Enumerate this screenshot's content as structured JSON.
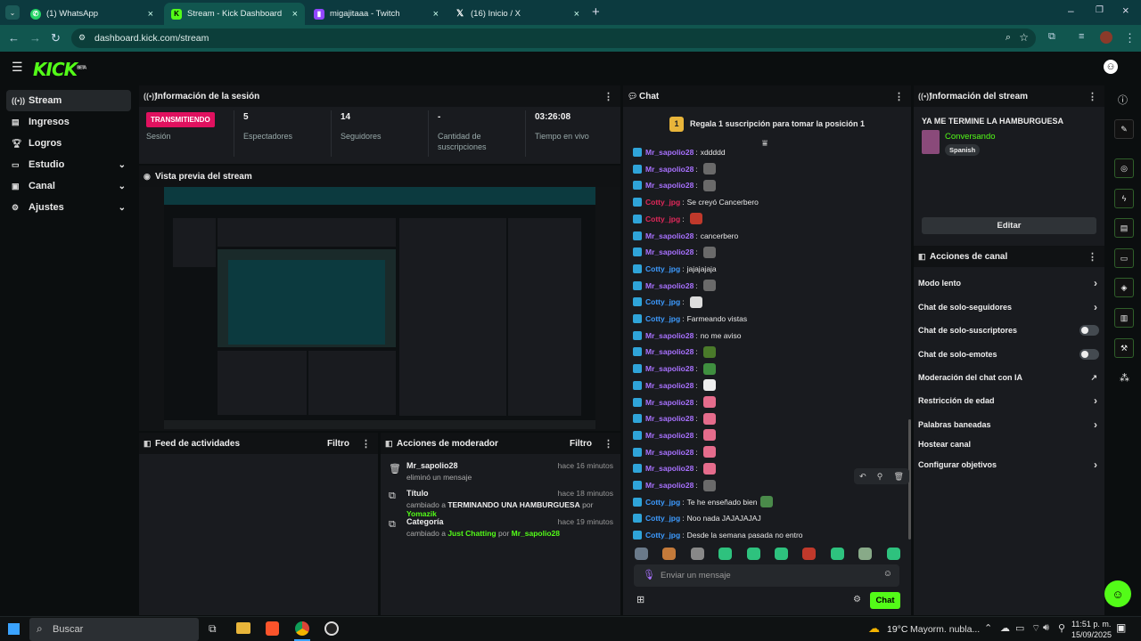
{
  "browser": {
    "tabs": [
      {
        "label": "(1) WhatsApp",
        "icon": "whatsapp-icon",
        "color": "#25d366"
      },
      {
        "label": "Stream - Kick Dashboard",
        "icon": "kick-icon",
        "color": "#53fc18"
      },
      {
        "label": "migajitaaa - Twitch",
        "icon": "twitch-icon",
        "color": "#9146ff"
      },
      {
        "label": "(16) Inicio / X",
        "icon": "x-icon",
        "color": "#000000"
      }
    ],
    "url": "dashboard.kick.com/stream"
  },
  "kick": {
    "logo": "KICK",
    "beta": "BETA",
    "accent": "#53fc18"
  },
  "sidebar": {
    "items": [
      {
        "label": "Stream",
        "icon": "broadcast-icon"
      },
      {
        "label": "Ingresos",
        "icon": "money-icon"
      },
      {
        "label": "Logros",
        "icon": "trophy-icon"
      },
      {
        "label": "Estudio",
        "icon": "studio-icon"
      },
      {
        "label": "Canal",
        "icon": "channel-icon"
      },
      {
        "label": "Ajustes",
        "icon": "gear-icon"
      }
    ]
  },
  "session": {
    "title": "Información de la sesión",
    "live_badge": "TRANSMITIENDO",
    "session_label": "Sesión",
    "stats": [
      {
        "value": "5",
        "label": "Espectadores"
      },
      {
        "value": "14",
        "label": "Seguidores"
      },
      {
        "value": "-",
        "label": "Cantidad de suscripciones"
      },
      {
        "value": "03:26:08",
        "label": "Tiempo en vivo"
      }
    ]
  },
  "preview": {
    "title": "Vista previa del stream"
  },
  "activity": {
    "title": "Feed de actividades",
    "filter": "Filtro"
  },
  "moderator": {
    "title": "Acciones de moderador",
    "filter": "Filtro",
    "items": [
      {
        "title": "Mr_sapolio28",
        "desc": "eliminó un mensaje",
        "time": "hace 16 minutos",
        "icon": "trash-icon"
      },
      {
        "title": "Título",
        "desc_pre": "cambiado a ",
        "value": "TERMINANDO UNA HAMBURGUESA",
        "by_pre": " por ",
        "by": "Yomazik",
        "time": "hace 18 minutos",
        "icon": "title-icon"
      },
      {
        "title": "Categoría",
        "desc_pre": "cambiado a ",
        "value": "Just Chatting",
        "by_pre": " por ",
        "by": "Mr_sapolio28",
        "time": "hace 19 minutos",
        "icon": "category-icon"
      }
    ]
  },
  "chat": {
    "title": "Chat",
    "gift_banner": "Regala 1 suscripción para tomar la posición 1",
    "gift_pos": "1",
    "messages": [
      {
        "user": "Mr_sapolio28",
        "text": "xddddd",
        "cls": "u-mr"
      },
      {
        "user": "Mr_sapolio28",
        "text": "",
        "cls": "u-mr",
        "emote": "#6a6a6a"
      },
      {
        "user": "Mr_sapolio28",
        "text": "",
        "cls": "u-mr",
        "emote": "#6a6a6a"
      },
      {
        "user": "Cotty_jpg",
        "text": "Se creyó Cancerbero",
        "cls": "u-cr"
      },
      {
        "user": "Cotty_jpg",
        "text": "",
        "cls": "u-cr",
        "emote": "#c0392b"
      },
      {
        "user": "Mr_sapolio28",
        "text": "cancerbero",
        "cls": "u-mr"
      },
      {
        "user": "Mr_sapolio28",
        "text": "",
        "cls": "u-mr",
        "emote": "#6a6a6a"
      },
      {
        "user": "Cotty_jpg",
        "text": "jajajajaja",
        "cls": "u-cb"
      },
      {
        "user": "Mr_sapolio28",
        "text": "",
        "cls": "u-mr",
        "emote": "#6a6a6a"
      },
      {
        "user": "Cotty_jpg",
        "text": "",
        "cls": "u-cb",
        "emote": "#dddddd"
      },
      {
        "user": "Cotty_jpg",
        "text": "Farmeando vistas",
        "cls": "u-cb"
      },
      {
        "user": "Mr_sapolio28",
        "text": "no me aviso",
        "cls": "u-mr"
      },
      {
        "user": "Mr_sapolio28",
        "text": "",
        "cls": "u-mr",
        "emote": "#4a7a2a"
      },
      {
        "user": "Mr_sapolio28",
        "text": "",
        "cls": "u-mr",
        "emote": "#3f8f3f"
      },
      {
        "user": "Mr_sapolio28",
        "text": "",
        "cls": "u-mr",
        "emote": "#eeeeee"
      },
      {
        "user": "Mr_sapolio28",
        "text": "",
        "cls": "u-mr",
        "emote": "#e56c8c"
      },
      {
        "user": "Mr_sapolio28",
        "text": "",
        "cls": "u-mr",
        "emote": "#e56c8c"
      },
      {
        "user": "Mr_sapolio28",
        "text": "",
        "cls": "u-mr",
        "emote": "#e56c8c"
      },
      {
        "user": "Mr_sapolio28",
        "text": "",
        "cls": "u-mr",
        "emote": "#e56c8c"
      },
      {
        "user": "Mr_sapolio28",
        "text": "",
        "cls": "u-mr",
        "emote": "#e56c8c"
      },
      {
        "user": "Mr_sapolio28",
        "text": "",
        "cls": "u-mr",
        "emote": "#6a6a6a"
      },
      {
        "user": "Cotty_jpg",
        "text": "Te he enseñado bien",
        "cls": "u-cb",
        "emote": "#4a8a4a"
      },
      {
        "user": "Cotty_jpg",
        "text": "Noo nada JAJAJAJAJ",
        "cls": "u-cb"
      },
      {
        "user": "Cotty_jpg",
        "text": "Desde la semana pasada no entro",
        "cls": "u-cb"
      }
    ],
    "input_placeholder": "Enviar un mensaje",
    "send_label": "Chat"
  },
  "stream_info": {
    "title": "Información del stream",
    "stream_title": "YA ME TERMINE LA HAMBURGUESA",
    "category": "Conversando",
    "language": "Spanish",
    "edit": "Editar"
  },
  "channel_actions": {
    "title": "Acciones de canal",
    "items": [
      {
        "label": "Modo lento",
        "kind": "arrow"
      },
      {
        "label": "Chat de solo-seguidores",
        "kind": "arrow"
      },
      {
        "label": "Chat de solo-suscriptores",
        "kind": "toggle"
      },
      {
        "label": "Chat de solo-emotes",
        "kind": "toggle"
      },
      {
        "label": "Moderación del chat con IA",
        "kind": "external"
      },
      {
        "label": "Restricción de edad",
        "kind": "arrow"
      },
      {
        "label": "Palabras baneadas",
        "kind": "arrow"
      },
      {
        "label": "Hostear canal",
        "kind": "none"
      },
      {
        "label": "Configurar objetivos",
        "kind": "arrow"
      }
    ]
  },
  "taskbar": {
    "search": "Buscar",
    "weather": "19°C",
    "weather_desc": "Mayorm. nubla...",
    "time": "11:51 p. m.",
    "date": "15/09/2025"
  }
}
